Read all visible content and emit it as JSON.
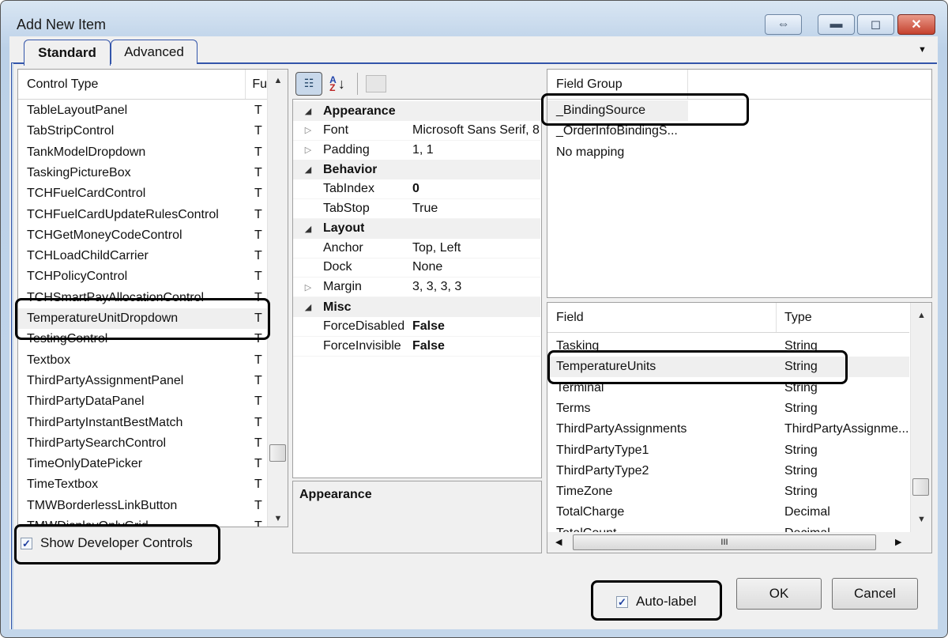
{
  "window": {
    "title": "Add New Item",
    "buttons": {
      "resize": "⇔",
      "minimize": "▬",
      "maximize": "◻",
      "close": "✕"
    }
  },
  "tabs": [
    {
      "label": "Standard",
      "active": true
    },
    {
      "label": "Advanced",
      "active": false
    }
  ],
  "tab_menu_icon": "▼",
  "control_list": {
    "headers": [
      "Control Type",
      "Fu"
    ],
    "rows": [
      {
        "name": "TableLayoutPanel",
        "col2": "T"
      },
      {
        "name": "TabStripControl",
        "col2": "T"
      },
      {
        "name": "TankModelDropdown",
        "col2": "T"
      },
      {
        "name": "TaskingPictureBox",
        "col2": "T"
      },
      {
        "name": "TCHFuelCardControl",
        "col2": "T"
      },
      {
        "name": "TCHFuelCardUpdateRulesControl",
        "col2": "T"
      },
      {
        "name": "TCHGetMoneyCodeControl",
        "col2": "T"
      },
      {
        "name": "TCHLoadChildCarrier",
        "col2": "T"
      },
      {
        "name": "TCHPolicyControl",
        "col2": "T"
      },
      {
        "name": "TCHSmartPayAllocationControl",
        "col2": "T"
      },
      {
        "name": "TemperatureUnitDropdown",
        "col2": "T",
        "selected": true
      },
      {
        "name": "TestingControl",
        "col2": "T"
      },
      {
        "name": "Textbox",
        "col2": "T"
      },
      {
        "name": "ThirdPartyAssignmentPanel",
        "col2": "T"
      },
      {
        "name": "ThirdPartyDataPanel",
        "col2": "T"
      },
      {
        "name": "ThirdPartyInstantBestMatch",
        "col2": "T"
      },
      {
        "name": "ThirdPartySearchControl",
        "col2": "T"
      },
      {
        "name": "TimeOnlyDatePicker",
        "col2": "T"
      },
      {
        "name": "TimeTextbox",
        "col2": "T"
      },
      {
        "name": "TMWBorderlessLinkButton",
        "col2": "T"
      },
      {
        "name": "TMWDisplayOnlyGrid",
        "col2": "T"
      }
    ],
    "show_developer_controls": {
      "label": "Show Developer Controls",
      "checked": true
    }
  },
  "property_grid": {
    "toolbar": [
      "categorized-icon",
      "alphabetical-icon",
      "property-pages-icon"
    ],
    "rows": [
      {
        "type": "cat",
        "name": "Appearance"
      },
      {
        "type": "prop",
        "exp": "▷",
        "name": "Font",
        "value": "Microsoft Sans Serif, 8"
      },
      {
        "type": "prop",
        "exp": "▷",
        "name": "Padding",
        "value": "1, 1"
      },
      {
        "type": "cat",
        "name": "Behavior"
      },
      {
        "type": "prop",
        "name": "TabIndex",
        "value": "0",
        "bold": true
      },
      {
        "type": "prop",
        "name": "TabStop",
        "value": "True"
      },
      {
        "type": "cat",
        "name": "Layout"
      },
      {
        "type": "prop",
        "name": "Anchor",
        "value": "Top, Left"
      },
      {
        "type": "prop",
        "name": "Dock",
        "value": "None"
      },
      {
        "type": "prop",
        "exp": "▷",
        "name": "Margin",
        "value": "3, 3, 3, 3"
      },
      {
        "type": "cat",
        "name": "Misc"
      },
      {
        "type": "prop",
        "name": "ForceDisabled",
        "value": "False",
        "bold": true
      },
      {
        "type": "prop",
        "name": "ForceInvisible",
        "value": "False",
        "bold": true
      }
    ],
    "description_title": "Appearance"
  },
  "field_group": {
    "header": "Field Group",
    "rows": [
      "_BindingSource",
      "_OrderInfoBindingS...",
      "No mapping"
    ]
  },
  "fields": {
    "headers": [
      "Field",
      "Type"
    ],
    "rows": [
      {
        "field": "Tasking",
        "type": "String"
      },
      {
        "field": "TemperatureUnits",
        "type": "String",
        "selected": true
      },
      {
        "field": "Terminal",
        "type": "String"
      },
      {
        "field": "Terms",
        "type": "String"
      },
      {
        "field": "ThirdPartyAssignments",
        "type": "ThirdPartyAssignme..."
      },
      {
        "field": "ThirdPartyType1",
        "type": "String"
      },
      {
        "field": "ThirdPartyType2",
        "type": "String"
      },
      {
        "field": "TimeZone",
        "type": "String"
      },
      {
        "field": "TotalCharge",
        "type": "Decimal"
      },
      {
        "field": "TotalCount",
        "type": "Decimal"
      }
    ],
    "hscroll_grip": "III"
  },
  "auto_label": {
    "label": "Auto-label",
    "checked": true
  },
  "ok_label": "OK",
  "cancel_label": "Cancel"
}
